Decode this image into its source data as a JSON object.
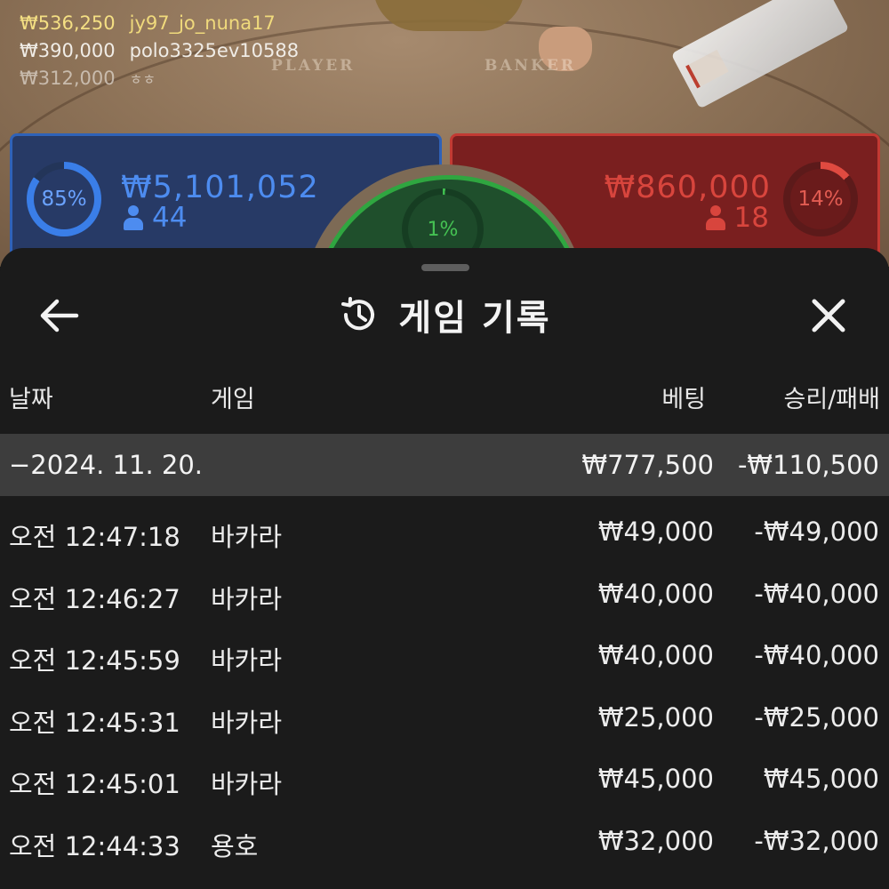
{
  "live_table": {
    "leaderboard": [
      {
        "amount": "₩536,250",
        "name": "jy97_jo_nuna17"
      },
      {
        "amount": "₩390,000",
        "name": "polo3325ev10588"
      },
      {
        "amount": "₩312,000",
        "name": "ㅎㅎ"
      }
    ],
    "felt_labels": {
      "player": "PLAYER",
      "banker": "BANKER"
    },
    "player_bet": {
      "percent": "85%",
      "percent_value": 85,
      "amount": "₩5,101,052",
      "players": "44",
      "color": "#3a7ee8"
    },
    "banker_bet": {
      "percent": "14%",
      "percent_value": 14,
      "amount": "₩860,000",
      "players": "18",
      "color": "#e04a40"
    },
    "tie_bet": {
      "percent": "1%",
      "percent_value": 1,
      "color": "#3fbd4f"
    }
  },
  "sheet": {
    "title": "게임 기록",
    "icons": {
      "back": "arrow-left-icon",
      "title": "history-icon",
      "close": "close-icon"
    },
    "columns": {
      "date": "날짜",
      "game": "게임",
      "bet": "베팅",
      "win_loss": "승리/패배"
    },
    "date_group": {
      "date": "−2024. 11. 20.",
      "bet": "₩777,500",
      "win_loss": "-₩110,500"
    },
    "rows": [
      {
        "time": "오전 12:47:18",
        "game": "바카라",
        "bet": "₩49,000",
        "win_loss": "-₩49,000"
      },
      {
        "time": "오전 12:46:27",
        "game": "바카라",
        "bet": "₩40,000",
        "win_loss": "-₩40,000"
      },
      {
        "time": "오전 12:45:59",
        "game": "바카라",
        "bet": "₩40,000",
        "win_loss": "-₩40,000"
      },
      {
        "time": "오전 12:45:31",
        "game": "바카라",
        "bet": "₩25,000",
        "win_loss": "-₩25,000"
      },
      {
        "time": "오전 12:45:01",
        "game": "바카라",
        "bet": "₩45,000",
        "win_loss": "₩45,000"
      },
      {
        "time": "오전 12:44:33",
        "game": "용호",
        "bet": "₩32,000",
        "win_loss": "-₩32,000"
      }
    ]
  }
}
